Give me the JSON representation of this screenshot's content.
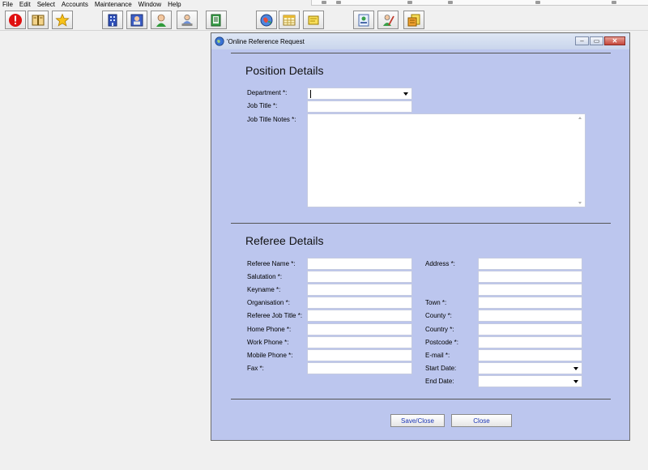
{
  "menu": [
    "File",
    "Edit",
    "Select",
    "Accounts",
    "Maintenance",
    "Window",
    "Help"
  ],
  "toolbar_icons": [
    "alert-icon",
    "book-icon",
    "star-icon",
    "building-icon",
    "contact-card-icon",
    "person-icon",
    "user-desk-icon",
    "document-icon",
    "globe-icon",
    "calendar-icon",
    "note-icon",
    "cv-icon",
    "person-edit-icon",
    "contracts-icon"
  ],
  "window": {
    "title": "'Online Reference Request"
  },
  "position": {
    "heading": "Position Details",
    "department_label": "Department *:",
    "department_value": "",
    "job_title_label": "Job Title *:",
    "job_title_value": "",
    "job_title_notes_label": "Job Title Notes *:",
    "job_title_notes_value": ""
  },
  "referee": {
    "heading": "Referee Details",
    "left": [
      {
        "label": "Referee Name *:",
        "value": ""
      },
      {
        "label": "Salutation *:",
        "value": ""
      },
      {
        "label": "Keyname *:",
        "value": ""
      },
      {
        "label": "Organisation *:",
        "value": ""
      },
      {
        "label": "Referee Job Title *:",
        "value": ""
      },
      {
        "label": "Home Phone *:",
        "value": ""
      },
      {
        "label": "Work Phone *:",
        "value": ""
      },
      {
        "label": "Mobile Phone *:",
        "value": ""
      },
      {
        "label": "Fax *:",
        "value": ""
      }
    ],
    "address_label": "Address *:",
    "right": [
      {
        "label": "Town *:",
        "value": ""
      },
      {
        "label": "County *:",
        "value": ""
      },
      {
        "label": "Country *:",
        "value": ""
      },
      {
        "label": "Postcode *:",
        "value": ""
      },
      {
        "label": "E-mail *:",
        "value": ""
      }
    ],
    "start_date_label": "Start Date:",
    "start_date_value": "",
    "end_date_label": "End Date:",
    "end_date_value": ""
  },
  "buttons": {
    "save_close": "Save/Close",
    "close": "Close"
  },
  "colors": {
    "dialog_bg": "#bcc6ee",
    "button_text": "#1a35b5",
    "close_button": "#c5473b"
  }
}
